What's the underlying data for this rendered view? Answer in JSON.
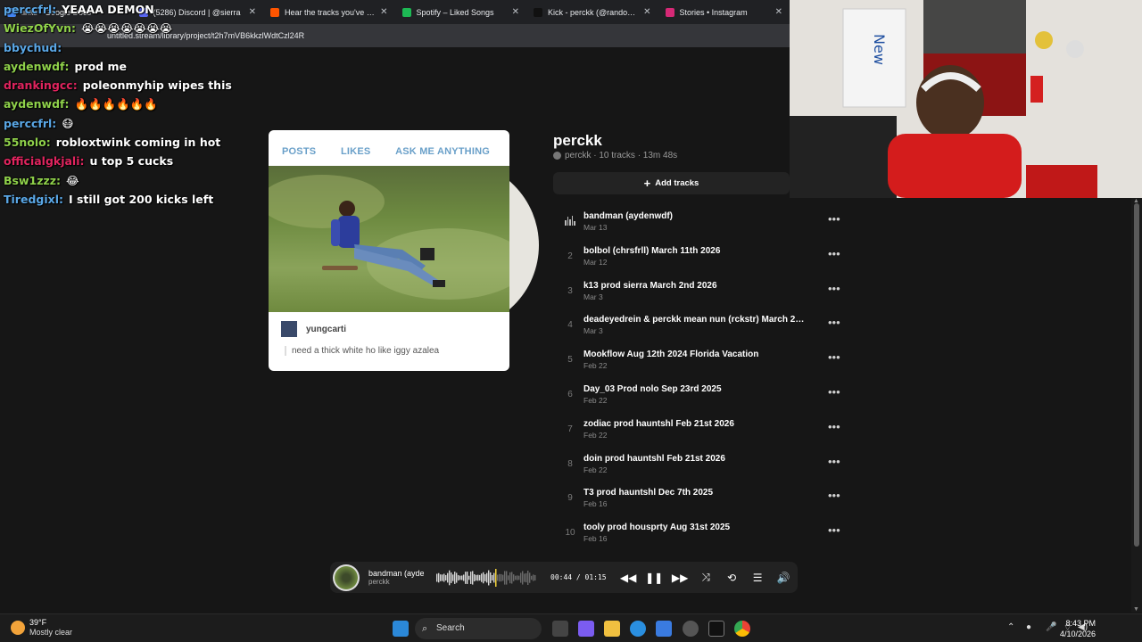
{
  "browser": {
    "tabs": [
      {
        "title": "links - Google Docs",
        "color": "#4285f4"
      },
      {
        "title": "(5286) Discord | @sierra",
        "color": "#5865f2"
      },
      {
        "title": "Hear the tracks you've liked",
        "color": "#ff5500"
      },
      {
        "title": "Spotify – Liked Songs",
        "color": "#1db954"
      },
      {
        "title": "Kick - perckk (@randomluh",
        "color": "#111111"
      },
      {
        "title": "Stories • Instagram",
        "color": "#d62976"
      }
    ],
    "url": "untitled.stream/library/project/t2h7mVB6kkzlWdtCzl24R"
  },
  "chat": [
    {
      "user": "perccfrl:",
      "text": "YEAAA DEMON",
      "color": "#5aa7e6"
    },
    {
      "user": "WiezOfYvn:",
      "text": "😭😭😭😭😭😭😭",
      "color": "#8fd14a"
    },
    {
      "user": "bbychud:",
      "text": "",
      "color": "#5aa7e6"
    },
    {
      "user": "aydenwdf:",
      "text": "prod me",
      "color": "#8fd14a"
    },
    {
      "user": "drankingcc:",
      "text": "poleonmyhip wipes this",
      "color": "#e0245e"
    },
    {
      "user": "aydenwdf:",
      "text": "🔥🔥🔥🔥🔥🔥",
      "color": "#8fd14a"
    },
    {
      "user": "perccfrl:",
      "text": "😷",
      "color": "#5aa7e6"
    },
    {
      "user": "55nolo:",
      "text": "robloxtwink coming in hot",
      "color": "#8fd14a"
    },
    {
      "user": "officialgkjali:",
      "text": "u top 5 cucks",
      "color": "#e0245e"
    },
    {
      "user": "Bsw1zzz:",
      "text": "😂",
      "color": "#8fd14a"
    },
    {
      "user": "Tiredgixl:",
      "text": "I still got 200 kicks left",
      "color": "#5aa7e6"
    }
  ],
  "card": {
    "tabs": [
      "POSTS",
      "LIKES",
      "ASK ME ANYTHING"
    ],
    "username": "yungcarti",
    "caption": "need a thick white ho like iggy azalea"
  },
  "playlist": {
    "title": "perckk",
    "meta": "perckk · 10 tracks · 13m 48s",
    "add_label": "Add tracks",
    "tracks": [
      {
        "num": "",
        "title": "bandman (aydenwdf)",
        "date": "Mar 13"
      },
      {
        "num": "2",
        "title": "bolbol (chrsfrll) March 11th 2026",
        "date": "Mar 12"
      },
      {
        "num": "3",
        "title": "k13 prod sierra March 2nd 2026",
        "date": "Mar 3"
      },
      {
        "num": "4",
        "title": "deadeyedrein & perckk mean nun (rckstr) March 2n...",
        "date": "Mar 3"
      },
      {
        "num": "5",
        "title": "Mookflow Aug 12th 2024 Florida Vacation",
        "date": "Feb 22"
      },
      {
        "num": "6",
        "title": "Day_03 Prod nolo Sep 23rd 2025",
        "date": "Feb 22"
      },
      {
        "num": "7",
        "title": "zodiac prod hauntshl Feb 21st 2026",
        "date": "Feb 22"
      },
      {
        "num": "8",
        "title": "doin prod hauntshl Feb 21st 2026",
        "date": "Feb 22"
      },
      {
        "num": "9",
        "title": "T3 prod hauntshl Dec 7th 2025",
        "date": "Feb 16"
      },
      {
        "num": "10",
        "title": "tooly prod housprty Aug 31st 2025",
        "date": "Feb 16"
      }
    ]
  },
  "player": {
    "title": "bandman (aydenwdf)",
    "artist": "perckk",
    "time": "00:44 / 01:15",
    "progress": 0.59
  },
  "taskbar": {
    "temp": "39°F",
    "condition": "Mostly clear",
    "search": "Search",
    "time": "8:43 PM",
    "date": "4/10/2026"
  }
}
